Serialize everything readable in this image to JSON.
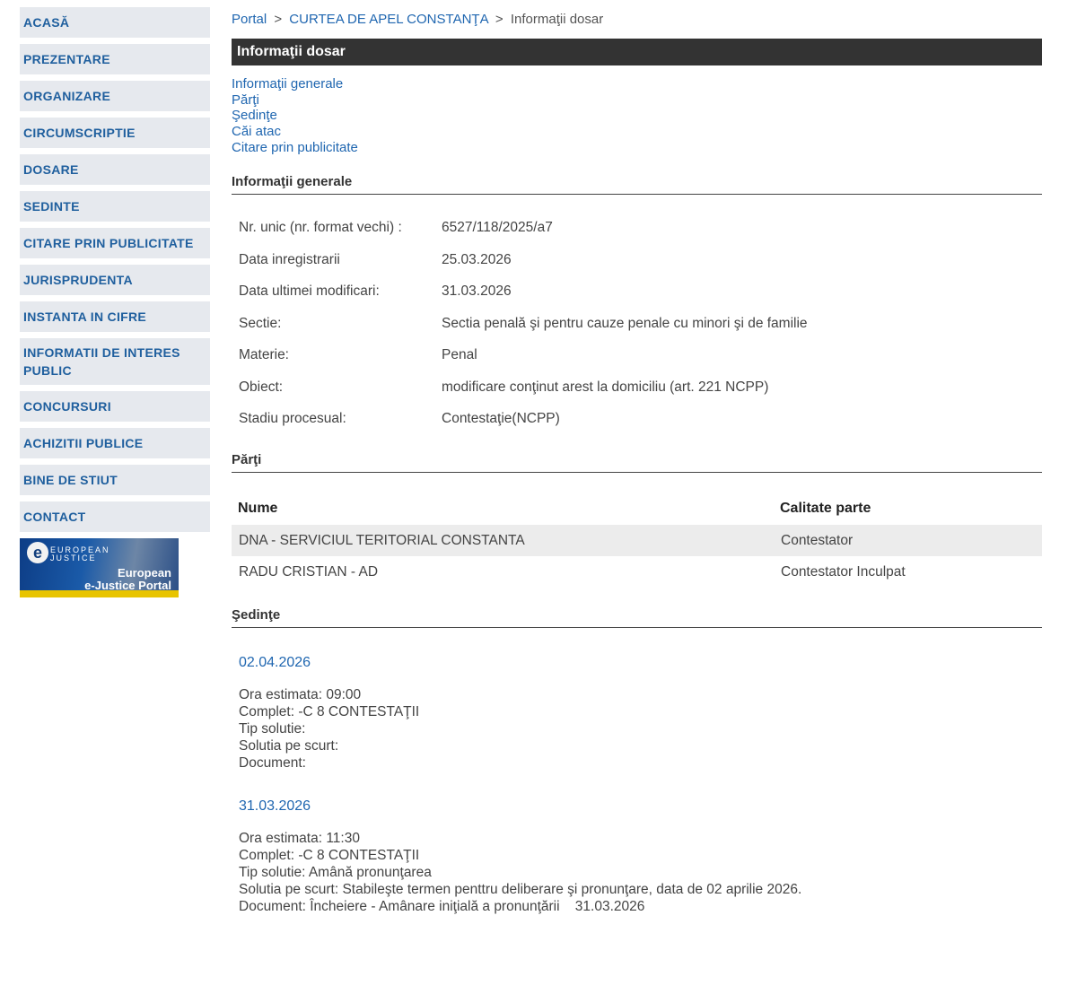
{
  "sidebar": {
    "items": [
      {
        "label": "ACASĂ"
      },
      {
        "label": "PREZENTARE"
      },
      {
        "label": "ORGANIZARE"
      },
      {
        "label": "CIRCUMSCRIPTIE"
      },
      {
        "label": "DOSARE"
      },
      {
        "label": "SEDINTE"
      },
      {
        "label": "CITARE PRIN PUBLICITATE"
      },
      {
        "label": "JURISPRUDENTA"
      },
      {
        "label": "INSTANTA IN CIFRE"
      },
      {
        "label": "INFORMATII DE INTERES PUBLIC"
      },
      {
        "label": "CONCURSURI"
      },
      {
        "label": "ACHIZITII PUBLICE"
      },
      {
        "label": "BINE DE STIUT"
      },
      {
        "label": "CONTACT"
      }
    ],
    "ejustice": {
      "small_line1": "EUROPEAN",
      "small_line2": "JUSTICE",
      "big_line1": "European",
      "big_line2": "e-Justice Portal"
    }
  },
  "breadcrumb": {
    "portal": "Portal",
    "separator": ">",
    "court": "CURTEA DE APEL CONSTANŢA",
    "current": "Informaţii dosar"
  },
  "title": "Informaţii dosar",
  "anchors": [
    "Informaţii generale",
    "Părţi",
    "Şedinţe",
    "Căi atac",
    "Citare prin publicitate"
  ],
  "general": {
    "heading": "Informaţii generale",
    "rows": [
      {
        "label": "Nr. unic (nr. format vechi) :",
        "value": "6527/118/2025/a7"
      },
      {
        "label": "Data inregistrarii",
        "value": "25.03.2026"
      },
      {
        "label": "Data ultimei modificari:",
        "value": "31.03.2026"
      },
      {
        "label": "Sectie:",
        "value": "Sectia penală şi pentru cauze penale cu minori şi de familie"
      },
      {
        "label": "Materie:",
        "value": "Penal"
      },
      {
        "label": "Obiect:",
        "value": "modificare conţinut arest la domiciliu (art. 221 NCPP)"
      },
      {
        "label": "Stadiu procesual:",
        "value": "Contestaţie(NCPP)"
      }
    ]
  },
  "parti": {
    "heading": "Părţi",
    "columns": [
      "Nume",
      "Calitate parte"
    ],
    "rows": [
      {
        "nume": "DNA - SERVICIUL TERITORIAL CONSTANTA",
        "calitate": "Contestator"
      },
      {
        "nume": "RADU CRISTIAN - AD",
        "calitate": "Contestator Inculpat"
      }
    ]
  },
  "sedinte": {
    "heading": "Şedinţe",
    "items": [
      {
        "date": "02.04.2026",
        "ora": "Ora estimata: 09:00",
        "complet": "Complet: -C 8 CONTESTAŢII",
        "tip": "Tip solutie:",
        "solutia": "Solutia pe scurt:",
        "document": "Document:"
      },
      {
        "date": "31.03.2026",
        "ora": "Ora estimata: 11:30",
        "complet": "Complet: -C 8 CONTESTAŢII",
        "tip": "Tip solutie: Amână pronunţarea",
        "solutia": "Solutia pe scurt: Stabileşte termen penttru deliberare şi pronunţare, data de 02 aprilie 2026.",
        "document": "Document: Încheiere - Amânare iniţială a pronunţării    31.03.2026"
      }
    ]
  },
  "colors": {
    "link": "#1f66b0",
    "nav_bg": "#e6e9ee",
    "title_bar": "#333333"
  }
}
